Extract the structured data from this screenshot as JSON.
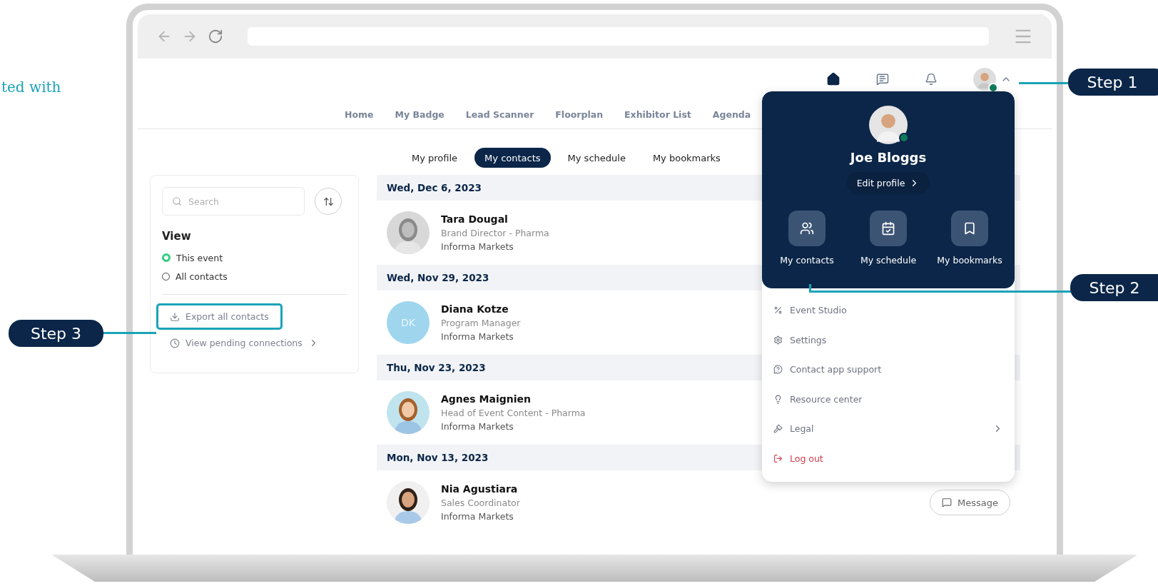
{
  "intro_text": "ted with",
  "header": {
    "user_online": true,
    "menu_open": true
  },
  "nav": [
    "Home",
    "My Badge",
    "Lead Scanner",
    "Floorplan",
    "Exhibitor List",
    "Agenda"
  ],
  "tabs": [
    {
      "label": "My profile",
      "selected": false
    },
    {
      "label": "My contacts",
      "selected": true
    },
    {
      "label": "My schedule",
      "selected": false
    },
    {
      "label": "My bookmarks",
      "selected": false
    }
  ],
  "sidebar": {
    "search": {
      "placeholder": "Search"
    },
    "view_title": "View",
    "view_options": [
      {
        "label": "This event",
        "selected": true
      },
      {
        "label": "All contacts",
        "selected": false
      }
    ],
    "actions": [
      {
        "label": "Export all contacts",
        "kind": "export",
        "highlighted": true
      },
      {
        "label": "View pending connections",
        "kind": "pending",
        "highlighted": false
      }
    ]
  },
  "contact_groups": [
    {
      "date": "Wed, Dec 6, 2023",
      "contacts": [
        {
          "name": "Tara Dougal",
          "title": "Brand Director - Pharma",
          "company": "Informa Markets"
        }
      ]
    },
    {
      "date": "Wed, Nov 29, 2023",
      "contacts": [
        {
          "name": "Diana Kotze",
          "title": "Program Manager",
          "company": "Informa Markets",
          "avatar": {
            "kind": "initials",
            "text": "DK"
          }
        }
      ]
    },
    {
      "date": "Thu, Nov 23, 2023",
      "contacts": [
        {
          "name": "Agnes Maignien",
          "title": "Head of Event Content - Pharma",
          "company": "Informa Markets"
        }
      ]
    },
    {
      "date": "Mon, Nov 13, 2023",
      "contacts": [
        {
          "name": "Nia Agustiara",
          "title": "Sales Coordinator",
          "company": "Informa Markets",
          "action": "Message"
        }
      ]
    }
  ],
  "profile_menu": {
    "name": "Joe Bloggs",
    "online": true,
    "edit_label": "Edit profile",
    "shortcuts": [
      {
        "label": "My contacts",
        "kind": "contacts"
      },
      {
        "label": "My schedule",
        "kind": "schedule"
      },
      {
        "label": "My bookmarks",
        "kind": "bookmarks"
      }
    ],
    "items": [
      {
        "label": "Event Studio",
        "kind": "studio",
        "danger": false
      },
      {
        "label": "Settings",
        "kind": "settings",
        "danger": false
      },
      {
        "label": "Contact app support",
        "kind": "support",
        "danger": false
      },
      {
        "label": "Resource center",
        "kind": "resources",
        "danger": false
      },
      {
        "label": "Legal",
        "kind": "legal",
        "danger": false,
        "submenu": true
      },
      {
        "label": "Log out",
        "kind": "logout",
        "danger": true
      }
    ]
  },
  "callouts": [
    {
      "label": "Step 1",
      "kind": "avatar"
    },
    {
      "label": "Step 2",
      "kind": "shortcut"
    },
    {
      "label": "Step 3",
      "kind": "export"
    }
  ]
}
